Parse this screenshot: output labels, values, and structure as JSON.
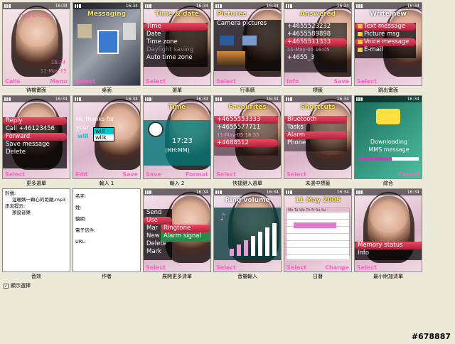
{
  "cells": [
    {
      "title": "Sony Ericsson",
      "extra1": "16:34",
      "extra2": "11-May-05",
      "sk_l": "Calls",
      "sk_r": "Menu",
      "caption": "待機畫面"
    },
    {
      "title": "Messaging",
      "sk_l": "Select",
      "sk_r": "",
      "caption": "桌面"
    },
    {
      "title": "Time & date",
      "items": [
        "Time",
        "Date",
        "Time zone",
        "Daylight saving",
        "Auto time zone"
      ],
      "sk_l": "Select",
      "caption": "選單"
    },
    {
      "title": "Pictures",
      "sub": "Camera pictures",
      "sk_l": "Select",
      "caption": "行事曆"
    },
    {
      "title": "Answered",
      "items": [
        "+4655523232",
        "+4655589898",
        "+4655511333",
        "11-May-05 16:05",
        "+4655_3"
      ],
      "sk_l": "Info",
      "sk_r": "Save",
      "caption": "標籤"
    },
    {
      "title": "Write new",
      "items": [
        "Text message",
        "Picture msg",
        "Voice message",
        "E-mail"
      ],
      "sk_l": "Select",
      "caption": "跳出畫面"
    },
    {
      "items": [
        "Reply",
        "Call +46123456",
        "Forward",
        "Save message",
        "Delete"
      ],
      "sk_l": "Select",
      "caption": "更多選單"
    },
    {
      "text1": "Hi, thanks for",
      "text2": "your",
      "opt1": "will",
      "opt2": "wilk",
      "opt3": "will",
      "sk_l": "Edit",
      "sk_r": "Save",
      "caption": "輸入 1"
    },
    {
      "title": "Time",
      "time": "17:23",
      "fmt": "(HH:MM)",
      "sk_l": "Save",
      "sk_r": "Format",
      "caption": "輸入 2"
    },
    {
      "title": "Favourites",
      "items": [
        "+4655553333",
        "+4655577711",
        "11-May-05 18:55",
        "+4688512"
      ],
      "sk_l": "Select",
      "caption": "快捷鍵入選單"
    },
    {
      "title": "Shortcuts",
      "items": [
        "Bluetooth",
        "Tasks",
        "Alarm",
        "Phone"
      ],
      "sk_l": "Select",
      "caption": "未選中標籤"
    },
    {
      "text1": "Downloading",
      "text2": "MMS message",
      "sk_r": "Cancel",
      "caption": "綜合"
    },
    {
      "l1": "鈴聲:",
      "l2": "溫暖媽一顆心的距離.mp3",
      "l3": "訊息提示:",
      "l4": "預設音樂",
      "caption": "音效"
    },
    {
      "l1": "名字:",
      "l2": "姓:",
      "l3": "鏡網:",
      "l4": "電子信件:",
      "l5": "URL:",
      "caption": "作者"
    },
    {
      "items": [
        "Send",
        "Use",
        "Mar",
        "New",
        "Delete",
        "Mark"
      ],
      "sub1": "Ringtone",
      "sub2": "Alarm signal",
      "sk_l": "Select",
      "caption": "展開更多清單"
    },
    {
      "title": "Ring volume",
      "sk_l": "Select",
      "caption": "音量輸入"
    },
    {
      "title": "11 May 2005",
      "days": "Mo Tu We Th Fr Sa Su",
      "sk_l": "Select",
      "sk_r": "Change",
      "caption": "日曆"
    },
    {
      "items": [
        "Memory status",
        "Info"
      ],
      "sk_l": "Select",
      "caption": "最小附加清單"
    }
  ],
  "checkbox_label": "顯示選擇",
  "watermark": "#678887",
  "status_time": "16:34"
}
